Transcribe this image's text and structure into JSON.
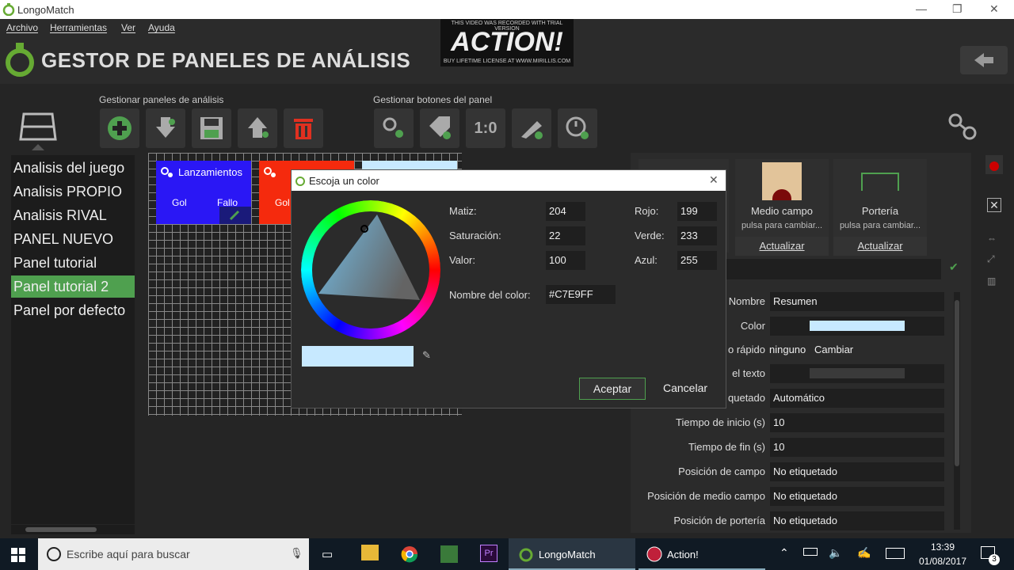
{
  "window": {
    "title": "LongoMatch",
    "min": "—",
    "max": "❐",
    "close": "✕"
  },
  "menu": [
    "Archivo",
    "Herramientas",
    "Ver",
    "Ayuda"
  ],
  "header": {
    "title": "GESTOR DE PANELES DE ANÁLISIS"
  },
  "watermark": {
    "top": "THIS VIDEO WAS RECORDED WITH TRIAL VERSION",
    "brand": "ACTION!",
    "bottom": "BUY LIFETIME LICENSE AT WWW.MIRILLIS.COM"
  },
  "toolbar": {
    "manage_panels_label": "Gestionar paneles de análisis",
    "manage_buttons_label": "Gestionar botones del panel",
    "ratio_label": "1:0"
  },
  "dashboards": [
    "Analisis del juego",
    "Analisis PROPIO",
    "Analisis RIVAL",
    "PANEL NUEVO",
    "Panel tutorial",
    "Panel tutorial 2",
    "Panel por defecto"
  ],
  "selected_dashboard": "Panel tutorial 2",
  "canvas_buttons": {
    "lanzamientos": {
      "title": "Lanzamientos",
      "tag1": "Gol",
      "tag2": "Fallo",
      "color": "#2a17f5"
    },
    "red": {
      "tag1": "Gol",
      "color": "#f52a0d"
    }
  },
  "backgrounds": [
    {
      "title": "Medio campo",
      "hint": "pulsa para cambiar...",
      "action": "Actualizar"
    },
    {
      "title": "Portería",
      "hint": "pulsa para cambiar...",
      "action": "Actualizar"
    }
  ],
  "properties": {
    "nombre_label": "Nombre",
    "nombre_value": "Resumen",
    "color_label": "Color",
    "color_value": "#C7E9FF",
    "hotkey_label": "o rápido",
    "hotkey_value": "ninguno",
    "hotkey_action": "Cambiar",
    "textcolor_label": "el texto",
    "tagmode_label": "quetado",
    "tagmode_value": "Automático",
    "start_label": "Tiempo de inicio (s)",
    "start_value": "10",
    "end_label": "Tiempo de fin (s)",
    "end_value": "10",
    "field_label": "Posición de campo",
    "field_value": "No etiquetado",
    "half_label": "Posición de medio campo",
    "half_value": "No etiquetado",
    "goal_label": "Posición de portería",
    "goal_value": "No etiquetado"
  },
  "dialog": {
    "title": "Escoja un color",
    "matiz_label": "Matiz:",
    "matiz": "204",
    "sat_label": "Saturación:",
    "sat": "22",
    "val_label": "Valor:",
    "val": "100",
    "rojo_label": "Rojo:",
    "rojo": "199",
    "verde_label": "Verde:",
    "verde": "233",
    "azul_label": "Azul:",
    "azul": "255",
    "name_label": "Nombre del color:",
    "name": "#C7E9FF",
    "ok": "Aceptar",
    "cancel": "Cancelar",
    "preview_color": "#c7e9ff"
  },
  "taskbar": {
    "search_placeholder": "Escribe aquí para buscar",
    "app1": "LongoMatch",
    "app2": "Action!",
    "time": "13:39",
    "date": "01/08/2017",
    "notifications": "3"
  }
}
